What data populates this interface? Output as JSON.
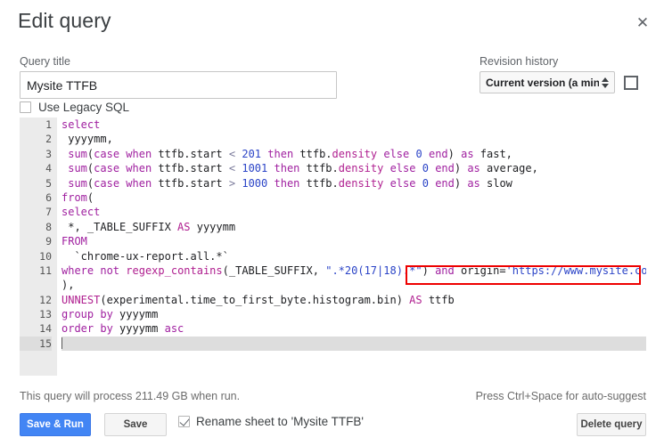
{
  "dialog": {
    "title": "Edit query",
    "close_icon": "close-icon"
  },
  "query_title": {
    "label": "Query title",
    "value": "Mysite TTFB",
    "placeholder": "Query title"
  },
  "legacy_sql": {
    "label": "Use Legacy SQL",
    "checked": false
  },
  "revision_history": {
    "label": "Revision history",
    "selected": "Current version (a minute ag",
    "expand_icon": "expand-icon"
  },
  "editor": {
    "active_line": 15,
    "lines": [
      {
        "num": "1",
        "tokens": [
          {
            "t": "select",
            "c": "kw"
          }
        ]
      },
      {
        "num": "2",
        "tokens": [
          {
            "t": " yyyymm,",
            "c": "pl"
          }
        ]
      },
      {
        "num": "3",
        "tokens": [
          {
            "t": " ",
            "c": "pl"
          },
          {
            "t": "sum",
            "c": "kw"
          },
          {
            "t": "(",
            "c": "pl"
          },
          {
            "t": "case when",
            "c": "kw"
          },
          {
            "t": " ttfb.start ",
            "c": "pl"
          },
          {
            "t": "<",
            "c": "op"
          },
          {
            "t": " ",
            "c": "pl"
          },
          {
            "t": "201",
            "c": "num"
          },
          {
            "t": " ",
            "c": "pl"
          },
          {
            "t": "then",
            "c": "kw"
          },
          {
            "t": " ttfb.",
            "c": "pl"
          },
          {
            "t": "density",
            "c": "kw2"
          },
          {
            "t": " ",
            "c": "pl"
          },
          {
            "t": "else",
            "c": "kw"
          },
          {
            "t": " ",
            "c": "pl"
          },
          {
            "t": "0",
            "c": "num"
          },
          {
            "t": " ",
            "c": "pl"
          },
          {
            "t": "end",
            "c": "kw"
          },
          {
            "t": ") ",
            "c": "pl"
          },
          {
            "t": "as",
            "c": "kw"
          },
          {
            "t": " fast,",
            "c": "pl"
          }
        ]
      },
      {
        "num": "4",
        "tokens": [
          {
            "t": " ",
            "c": "pl"
          },
          {
            "t": "sum",
            "c": "kw"
          },
          {
            "t": "(",
            "c": "pl"
          },
          {
            "t": "case when",
            "c": "kw"
          },
          {
            "t": " ttfb.start ",
            "c": "pl"
          },
          {
            "t": "<",
            "c": "op"
          },
          {
            "t": " ",
            "c": "pl"
          },
          {
            "t": "1001",
            "c": "num"
          },
          {
            "t": " ",
            "c": "pl"
          },
          {
            "t": "then",
            "c": "kw"
          },
          {
            "t": " ttfb.",
            "c": "pl"
          },
          {
            "t": "density",
            "c": "kw2"
          },
          {
            "t": " ",
            "c": "pl"
          },
          {
            "t": "else",
            "c": "kw"
          },
          {
            "t": " ",
            "c": "pl"
          },
          {
            "t": "0",
            "c": "num"
          },
          {
            "t": " ",
            "c": "pl"
          },
          {
            "t": "end",
            "c": "kw"
          },
          {
            "t": ") ",
            "c": "pl"
          },
          {
            "t": "as",
            "c": "kw"
          },
          {
            "t": " average,",
            "c": "pl"
          }
        ]
      },
      {
        "num": "5",
        "tokens": [
          {
            "t": " ",
            "c": "pl"
          },
          {
            "t": "sum",
            "c": "kw"
          },
          {
            "t": "(",
            "c": "pl"
          },
          {
            "t": "case when",
            "c": "kw"
          },
          {
            "t": " ttfb.start ",
            "c": "pl"
          },
          {
            "t": ">",
            "c": "op"
          },
          {
            "t": " ",
            "c": "pl"
          },
          {
            "t": "1000",
            "c": "num"
          },
          {
            "t": " ",
            "c": "pl"
          },
          {
            "t": "then",
            "c": "kw"
          },
          {
            "t": " ttfb.",
            "c": "pl"
          },
          {
            "t": "density",
            "c": "kw2"
          },
          {
            "t": " ",
            "c": "pl"
          },
          {
            "t": "else",
            "c": "kw"
          },
          {
            "t": " ",
            "c": "pl"
          },
          {
            "t": "0",
            "c": "num"
          },
          {
            "t": " ",
            "c": "pl"
          },
          {
            "t": "end",
            "c": "kw"
          },
          {
            "t": ") ",
            "c": "pl"
          },
          {
            "t": "as",
            "c": "kw"
          },
          {
            "t": " slow",
            "c": "pl"
          }
        ]
      },
      {
        "num": "6",
        "tokens": [
          {
            "t": "from",
            "c": "kw"
          },
          {
            "t": "(",
            "c": "pl"
          }
        ]
      },
      {
        "num": "7",
        "tokens": [
          {
            "t": "select",
            "c": "kw"
          }
        ]
      },
      {
        "num": "8",
        "tokens": [
          {
            "t": " *, _TABLE_SUFFIX ",
            "c": "pl"
          },
          {
            "t": "AS",
            "c": "kw2"
          },
          {
            "t": " yyyymm",
            "c": "pl"
          }
        ]
      },
      {
        "num": "9",
        "tokens": [
          {
            "t": "FROM",
            "c": "kw"
          }
        ]
      },
      {
        "num": "10",
        "tokens": [
          {
            "t": "  `chrome-ux-report.all.*`",
            "c": "pl"
          }
        ]
      },
      {
        "num": "11",
        "tokens": [
          {
            "t": "where not",
            "c": "kw"
          },
          {
            "t": " ",
            "c": "pl"
          },
          {
            "t": "regexp_contains",
            "c": "kw2"
          },
          {
            "t": "(_TABLE_SUFFIX, ",
            "c": "pl"
          },
          {
            "t": "\".*20(17|18).*\"",
            "c": "str"
          },
          {
            "t": ") ",
            "c": "pl"
          },
          {
            "t": "and",
            "c": "kw"
          },
          {
            "t": " origin=",
            "c": "pl"
          },
          {
            "t": "'https://www.mysite.com'",
            "c": "str"
          }
        ]
      },
      {
        "num": "",
        "tokens": [
          {
            "t": "),",
            "c": "pl"
          }
        ]
      },
      {
        "num": "12",
        "tokens": [
          {
            "t": "UNNEST",
            "c": "kw2"
          },
          {
            "t": "(experimental.time_to_first_byte.histogram.bin) ",
            "c": "pl"
          },
          {
            "t": "AS",
            "c": "kw2"
          },
          {
            "t": " ttfb",
            "c": "pl"
          }
        ]
      },
      {
        "num": "13",
        "tokens": [
          {
            "t": "group by",
            "c": "kw"
          },
          {
            "t": " yyyymm",
            "c": "pl"
          }
        ]
      },
      {
        "num": "14",
        "tokens": [
          {
            "t": "order by",
            "c": "kw"
          },
          {
            "t": " yyyymm ",
            "c": "pl"
          },
          {
            "t": "asc",
            "c": "kw"
          }
        ]
      },
      {
        "num": "15",
        "tokens": []
      }
    ]
  },
  "footer": {
    "status": "This query will process 211.49 GB when run.",
    "hint": "Press Ctrl+Space for auto-suggest",
    "save_and_run_label": "Save & Run",
    "save_label": "Save",
    "rename_label": "Rename sheet to 'Mysite TTFB'",
    "rename_checked": true,
    "delete_label": "Delete query"
  },
  "colors": {
    "primary": "#4285f4",
    "highlight_box": "#ee0000",
    "keyword": "#a020a0",
    "number": "#2b44c7",
    "string": "#2b44c7"
  }
}
